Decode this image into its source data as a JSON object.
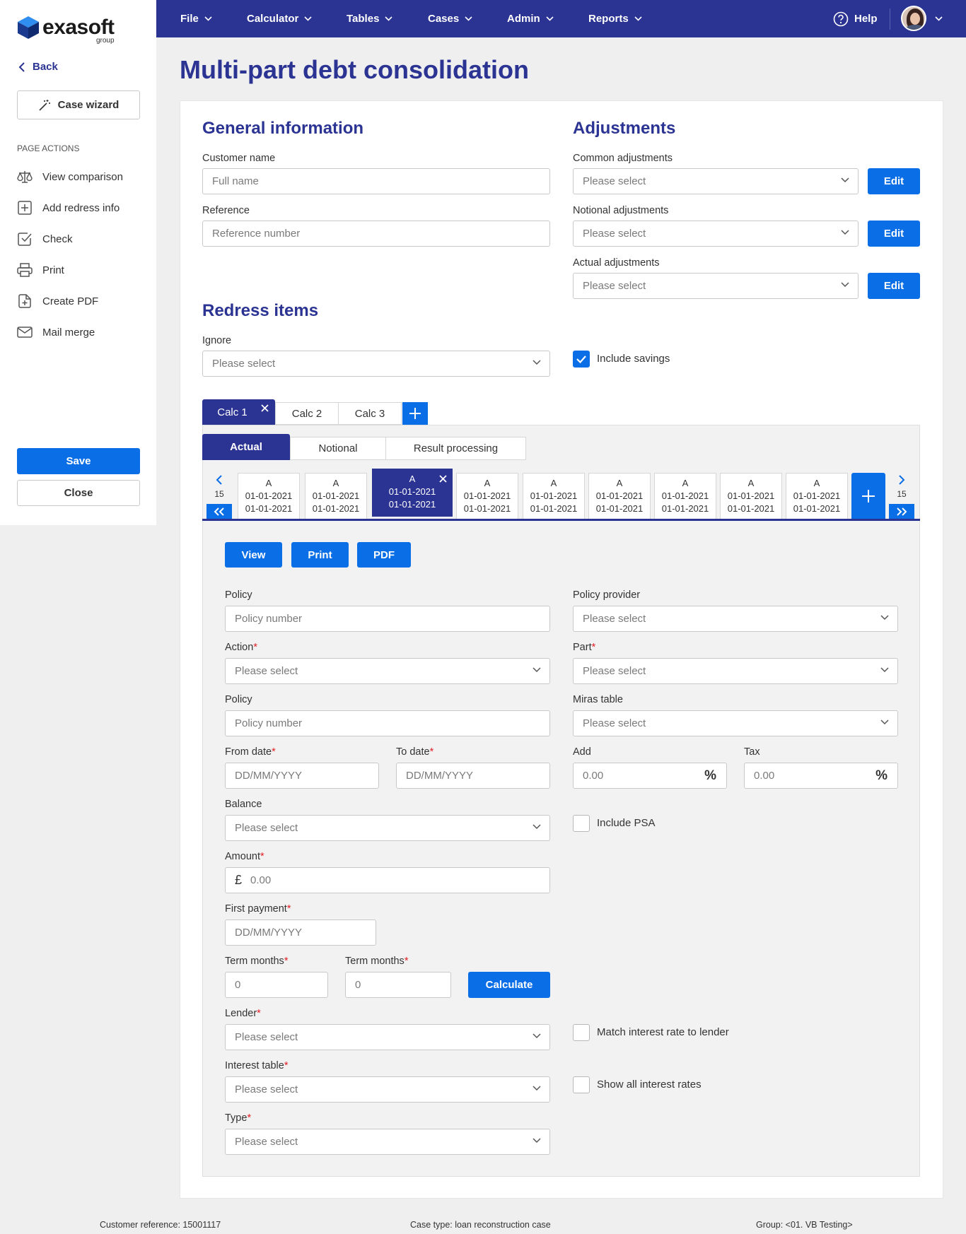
{
  "brand": {
    "name": "exasoft",
    "sub": "group"
  },
  "sidebar": {
    "back_label": "Back",
    "wizard_label": "Case wizard",
    "actions_heading": "PAGE ACTIONS",
    "items": [
      {
        "label": "View comparison",
        "icon": "scales-icon"
      },
      {
        "label": "Add redress info",
        "icon": "plus-square-icon"
      },
      {
        "label": "Check",
        "icon": "check-square-icon"
      },
      {
        "label": "Print",
        "icon": "printer-icon"
      },
      {
        "label": "Create PDF",
        "icon": "file-plus-icon"
      },
      {
        "label": "Mail merge",
        "icon": "mail-icon"
      }
    ],
    "save_label": "Save",
    "close_label": "Close"
  },
  "topnav": {
    "items": [
      "File",
      "Calculator",
      "Tables",
      "Cases",
      "Admin",
      "Reports"
    ],
    "help_label": "Help"
  },
  "page": {
    "title": "Multi-part debt consolidation"
  },
  "general": {
    "title": "General information",
    "customer_label": "Customer name",
    "customer_placeholder": "Full name",
    "reference_label": "Reference",
    "reference_placeholder": "Reference number"
  },
  "adjustments": {
    "title": "Adjustments",
    "common_label": "Common adjustments",
    "notional_label": "Notional adjustments",
    "actual_label": "Actual adjustments",
    "placeholder": "Please select",
    "edit_label": "Edit"
  },
  "redress": {
    "title": "Redress items",
    "ignore_label": "Ignore",
    "ignore_placeholder": "Please select",
    "include_savings_label": "Include savings",
    "include_savings_checked": true
  },
  "calc_tabs": [
    {
      "label": "Calc 1",
      "active": true
    },
    {
      "label": "Calc 2",
      "active": false
    },
    {
      "label": "Calc 3",
      "active": false
    }
  ],
  "sub_tabs": [
    {
      "label": "Actual",
      "active": true
    },
    {
      "label": "Notional",
      "active": false
    },
    {
      "label": "Result processing",
      "active": false
    }
  ],
  "parts": {
    "left_count": "15",
    "right_count": "15",
    "items": [
      {
        "letter": "A",
        "from": "01-01-2021",
        "to": "01-01-2021",
        "active": false
      },
      {
        "letter": "A",
        "from": "01-01-2021",
        "to": "01-01-2021",
        "active": false
      },
      {
        "letter": "A",
        "from": "01-01-2021",
        "to": "01-01-2021",
        "active": true
      },
      {
        "letter": "A",
        "from": "01-01-2021",
        "to": "01-01-2021",
        "active": false
      },
      {
        "letter": "A",
        "from": "01-01-2021",
        "to": "01-01-2021",
        "active": false
      },
      {
        "letter": "A",
        "from": "01-01-2021",
        "to": "01-01-2021",
        "active": false
      },
      {
        "letter": "A",
        "from": "01-01-2021",
        "to": "01-01-2021",
        "active": false
      },
      {
        "letter": "A",
        "from": "01-01-2021",
        "to": "01-01-2021",
        "active": false
      },
      {
        "letter": "A",
        "from": "01-01-2021",
        "to": "01-01-2021",
        "active": false
      }
    ]
  },
  "actions": {
    "view": "View",
    "print": "Print",
    "pdf": "PDF"
  },
  "form": {
    "policy_label": "Policy",
    "policy_placeholder": "Policy number",
    "provider_label": "Policy provider",
    "action_label": "Action",
    "part_label": "Part",
    "policy2_label": "Policy",
    "policy2_placeholder": "Policy number",
    "miras_label": "Miras table",
    "from_label": "From date",
    "to_label": "To date",
    "date_placeholder": "DD/MM/YYYY",
    "add_label": "Add",
    "tax_label": "Tax",
    "pct_value": "0.00",
    "pct_symbol": "%",
    "balance_label": "Balance",
    "include_psa_label": "Include PSA",
    "amount_label": "Amount",
    "currency": "£",
    "amount_value": "0.00",
    "first_payment_label": "First payment",
    "term1_label": "Term months",
    "term2_label": "Term months",
    "term_value": "0",
    "calculate_label": "Calculate",
    "lender_label": "Lender",
    "match_label": "Match interest rate to lender",
    "interest_label": "Interest table",
    "show_all_label": "Show all interest rates",
    "type_label": "Type",
    "select_placeholder": "Please select",
    "required_mark": "*"
  },
  "footer": {
    "customer_ref": "Customer reference: 15001117",
    "case_type": "Case type: loan reconstruction case",
    "group": "Group: <01. VB Testing>"
  },
  "colors": {
    "navy": "#2b3393",
    "accent": "#0a6ee6",
    "required": "#e21f26"
  }
}
